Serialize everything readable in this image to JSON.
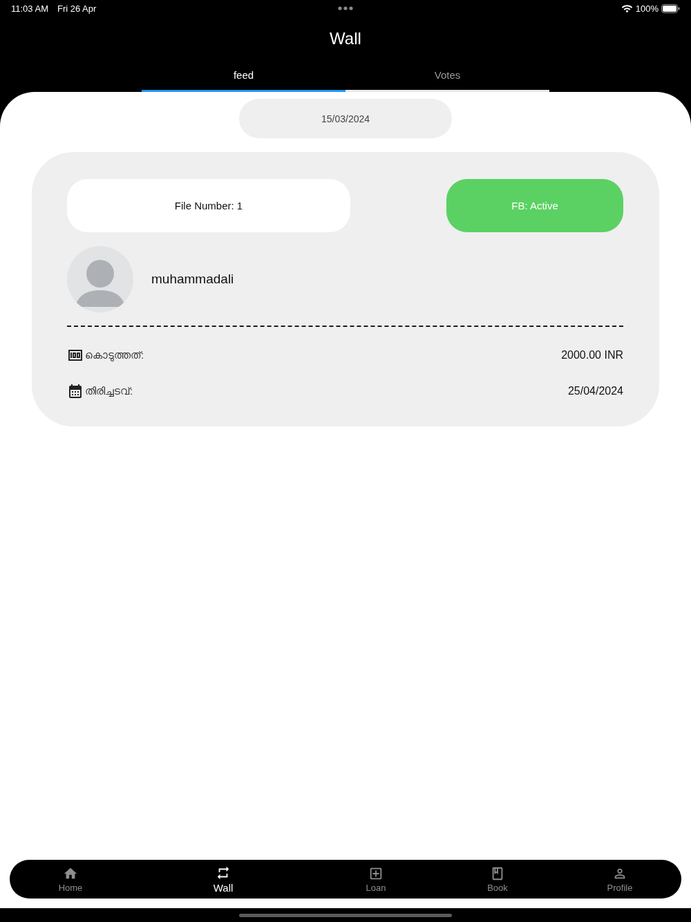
{
  "status_bar": {
    "time": "11:03 AM",
    "date": "Fri 26 Apr",
    "battery": "100%"
  },
  "header": {
    "title": "Wall"
  },
  "tabs": [
    {
      "label": "feed",
      "selected": true
    },
    {
      "label": "Votes",
      "selected": false
    }
  ],
  "date_chip": "15/03/2024",
  "cards": [
    {
      "file_number": "File Number: 1",
      "fb_status": "FB: Active",
      "active": true,
      "name": "muhammadali",
      "rows": [
        {
          "kind": "money",
          "label": "കൊടുത്തത്:",
          "value": "2000.00 INR"
        },
        {
          "kind": "calendar",
          "label": "തിരിച്ചടവ്:",
          "value": "25/04/2024"
        }
      ]
    }
  ],
  "bottom_nav": [
    {
      "kind": "home",
      "label": "Home",
      "selected": false
    },
    {
      "kind": "repeat",
      "label": "Wall",
      "selected": true
    },
    {
      "kind": "add",
      "label": "Loan",
      "selected": false
    },
    {
      "kind": "book",
      "label": "Book",
      "selected": false
    },
    {
      "kind": "profile",
      "label": "Profile",
      "selected": false
    }
  ]
}
